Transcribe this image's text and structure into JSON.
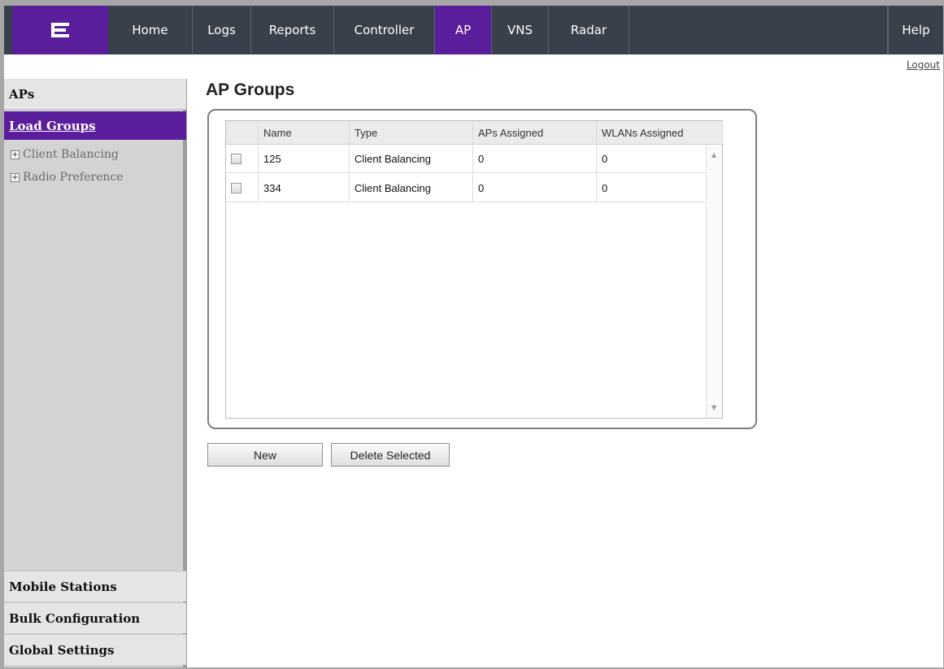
{
  "nav": {
    "logo_icon": "extreme-logo-icon",
    "items": [
      {
        "label": "Home"
      },
      {
        "label": "Logs"
      },
      {
        "label": "Reports"
      },
      {
        "label": "Controller"
      },
      {
        "label": "AP",
        "active": true
      },
      {
        "label": "VNS"
      },
      {
        "label": "Radar"
      }
    ],
    "help_label": "Help",
    "logout_label": "Logout"
  },
  "sidebar": {
    "header": "APs",
    "active_item": "Load Groups",
    "tree": [
      {
        "label": "Client Balancing",
        "icon": "expand-plus-icon"
      },
      {
        "label": "Radio Preference",
        "icon": "expand-plus-icon"
      }
    ],
    "footer": [
      {
        "label": "Mobile Stations"
      },
      {
        "label": "Bulk Configuration"
      },
      {
        "label": "Global Settings"
      }
    ]
  },
  "main": {
    "title": "AP Groups",
    "table": {
      "columns": [
        "Name",
        "Type",
        "APs Assigned",
        "WLANs Assigned"
      ],
      "rows": [
        {
          "name": "125",
          "type": "Client Balancing",
          "aps": "0",
          "wlans": "0",
          "checked": false
        },
        {
          "name": "334",
          "type": "Client Balancing",
          "aps": "0",
          "wlans": "0",
          "checked": false
        }
      ]
    },
    "buttons": {
      "new_label": "New",
      "delete_label": "Delete Selected"
    }
  },
  "colors": {
    "nav_bg": "#38404b",
    "accent": "#5a1d9c",
    "sidebar_bg": "#d3d3d3"
  }
}
